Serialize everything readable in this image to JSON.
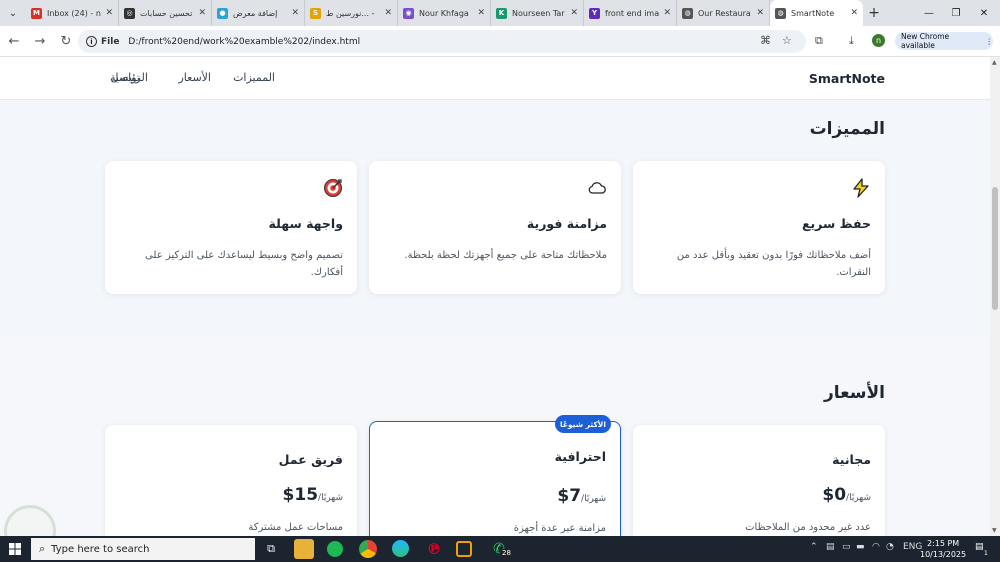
{
  "browser": {
    "tabs": [
      {
        "label": "Inbox (24) - n",
        "fav": "M",
        "color": "#d93025"
      },
      {
        "label": "تحسين حسابات",
        "fav": "◎",
        "color": "#333333"
      },
      {
        "label": "إضافة معرض",
        "fav": "●",
        "color": "#2aa3d9"
      },
      {
        "label": "نورسين ط... -",
        "fav": "S",
        "color": "#e8a200"
      },
      {
        "label": "Nour Khfaga",
        "fav": "◉",
        "color": "#7b4fc9"
      },
      {
        "label": "Nourseen Tar",
        "fav": "K",
        "color": "#1a9a6c"
      },
      {
        "label": "front end ima",
        "fav": "Y",
        "color": "#5f2bb8"
      },
      {
        "label": "Our Restaura",
        "fav": "◍",
        "color": "#555555"
      },
      {
        "label": "SmartNote",
        "fav": "◍",
        "color": "#555555"
      }
    ],
    "active_tab": 8,
    "url_scheme": "File",
    "url": "D:/front%20end/work%20examble%202/index.html",
    "new_chrome": "New Chrome available",
    "profile_initial": "n"
  },
  "site": {
    "brand": "SmartNote",
    "nav": [
      "الرئيسية",
      "المميزات",
      "الأسعار",
      "تواصل"
    ],
    "features_title": "المميزات",
    "features": [
      {
        "title": "حفظ سريع",
        "desc": "أضف ملاحظاتك فورًا بدون تعقيد وبأقل عدد من النقرات.",
        "icon": "lightning-icon"
      },
      {
        "title": "مزامنة فورية",
        "desc": "ملاحظاتك متاحة على جميع أجهزتك لحظة بلحظة.",
        "icon": "cloud-icon"
      },
      {
        "title": "واجهة سهلة",
        "desc": "تصميم واضح وبسيط ليساعدك على التركيز على أفكارك.",
        "icon": "target-icon"
      }
    ],
    "pricing_title": "الأسعار",
    "plans": [
      {
        "name": "مجانية",
        "price": "$0",
        "period": "/شهريًا",
        "feature": "عدد غير محدود من الملاحظات"
      },
      {
        "name": "احترافية",
        "price": "$7",
        "period": "/شهريًا",
        "feature": "مزامنة عبر عدة أجهزة",
        "badge": "الأكثر شيوعًا"
      },
      {
        "name": "فريق عمل",
        "price": "$15",
        "period": "/شهريًا",
        "feature": "مساحات عمل مشتركة"
      }
    ]
  },
  "taskbar": {
    "search_placeholder": "Type here to search",
    "whatsapp_badge": "28",
    "language": "ENG",
    "time": "2:15 PM",
    "date": "10/13/2025",
    "notifications": "1"
  },
  "colors": {
    "accent": "#1d5fd6",
    "page_bg": "#f3f6fb",
    "taskbar": "#1c2430"
  }
}
